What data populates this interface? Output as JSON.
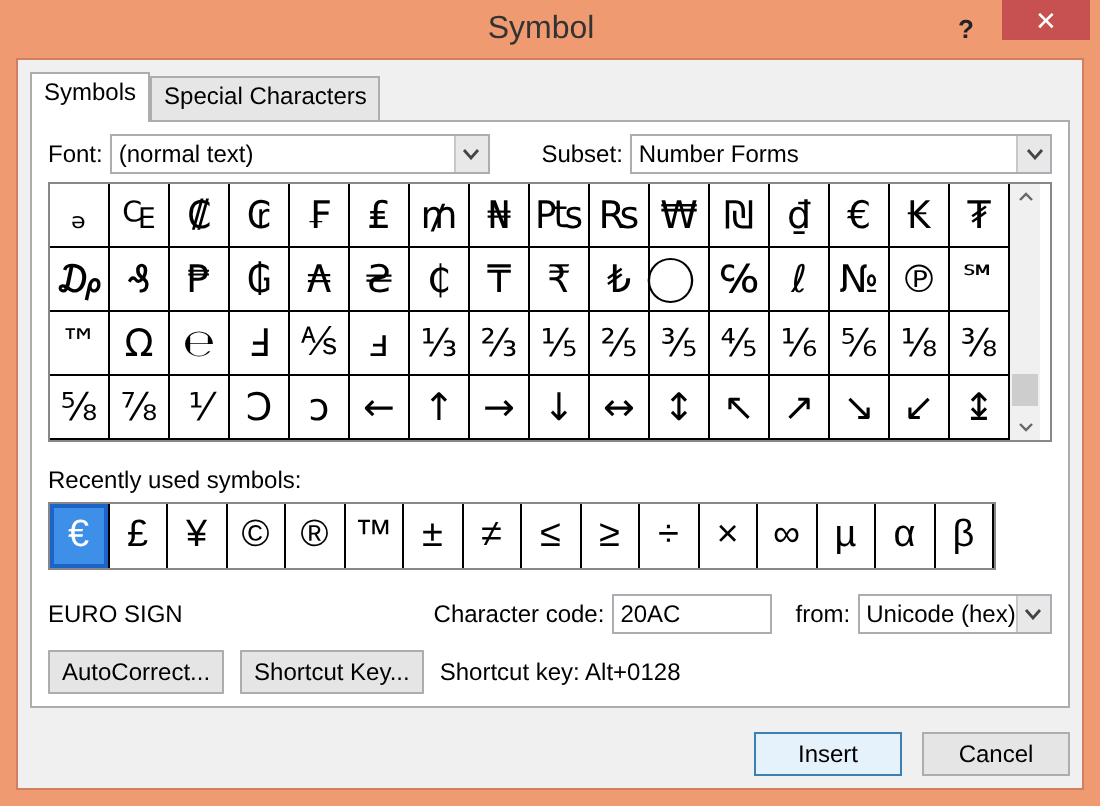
{
  "window": {
    "title": "Symbol",
    "help": "?",
    "close": "✕"
  },
  "tabs": [
    {
      "label": "Symbols",
      "selected": true
    },
    {
      "label": "Special Characters",
      "selected": false
    }
  ],
  "font": {
    "label": "Font:",
    "value": "(normal text)"
  },
  "subset": {
    "label": "Subset:",
    "value": "Number Forms"
  },
  "grid": [
    [
      "ₔ",
      "₠",
      "₡",
      "₢",
      "₣",
      "₤",
      "₥",
      "₦",
      "₧",
      "₨",
      "₩",
      "₪",
      "₫",
      "€",
      "₭",
      "₮"
    ],
    [
      "₯",
      "₰",
      "₱",
      "₲",
      "₳",
      "₴",
      "₵",
      "₸",
      "₹",
      "₺",
      "⃝",
      "℅",
      "ℓ",
      "№",
      "℗",
      "℠"
    ],
    [
      "™",
      "Ω",
      "℮",
      "Ⅎ",
      "⅍",
      "ⅎ",
      "⅓",
      "⅔",
      "⅕",
      "⅖",
      "⅗",
      "⅘",
      "⅙",
      "⅚",
      "⅛",
      "⅜"
    ],
    [
      "⅝",
      "⅞",
      "⅟",
      "Ↄ",
      "ↄ",
      "←",
      "↑",
      "→",
      "↓",
      "↔",
      "↕",
      "↖",
      "↗",
      "↘",
      "↙",
      "↨"
    ]
  ],
  "recent": {
    "label": "Recently used symbols:",
    "symbols": [
      {
        "char": "€",
        "selected": true
      },
      {
        "char": "£",
        "selected": false
      },
      {
        "char": "¥",
        "selected": false
      },
      {
        "char": "©",
        "selected": false
      },
      {
        "char": "®",
        "selected": false
      },
      {
        "char": "™",
        "selected": false
      },
      {
        "char": "±",
        "selected": false
      },
      {
        "char": "≠",
        "selected": false
      },
      {
        "char": "≤",
        "selected": false
      },
      {
        "char": "≥",
        "selected": false
      },
      {
        "char": "÷",
        "selected": false
      },
      {
        "char": "×",
        "selected": false
      },
      {
        "char": "∞",
        "selected": false
      },
      {
        "char": "µ",
        "selected": false
      },
      {
        "char": "α",
        "selected": false
      },
      {
        "char": "β",
        "selected": false
      }
    ]
  },
  "char_name": "EURO SIGN",
  "char_code": {
    "label": "Character code:",
    "value": "20AC"
  },
  "from": {
    "label": "from:",
    "value": "Unicode (hex)"
  },
  "buttons": [
    "AutoCorrect...",
    "Shortcut Key..."
  ],
  "shortcut_text": "Shortcut key: Alt+0128",
  "footer_buttons": [
    {
      "label": "Insert",
      "default": true
    },
    {
      "label": "Cancel",
      "default": false
    }
  ]
}
